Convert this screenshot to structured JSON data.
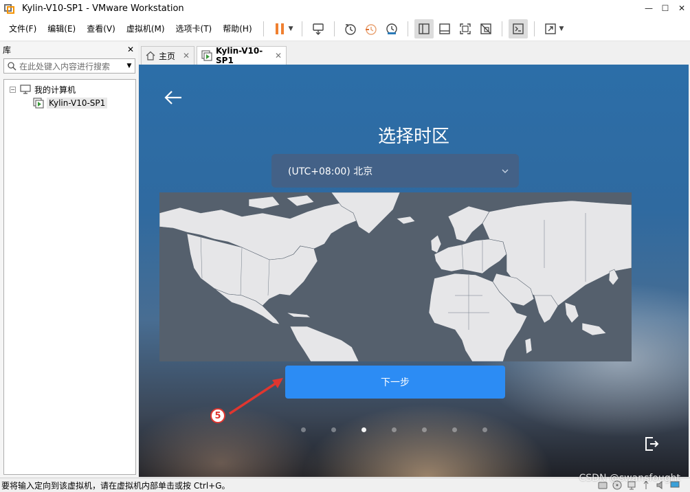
{
  "window": {
    "title": "Kylin-V10-SP1 - VMware Workstation",
    "minimize": "—",
    "maximize": "☐",
    "close": "✕"
  },
  "menu": [
    "文件(F)",
    "编辑(E)",
    "查看(V)",
    "虚拟机(M)",
    "选项卡(T)",
    "帮助(H)"
  ],
  "library": {
    "title": "库",
    "close": "✕",
    "search_placeholder": "在此处键入内容进行搜索",
    "tree_root": "我的计算机",
    "tree_toggle": "−",
    "tree_child": "Kylin-V10-SP1"
  },
  "tabs": [
    {
      "label": "主页",
      "close": "✕"
    },
    {
      "label": "Kylin-V10-SP1",
      "close": "✕"
    }
  ],
  "vm": {
    "title": "选择时区",
    "timezone_value": "(UTC+08:00) 北京",
    "next_button": "下一步",
    "page_dots": 7,
    "active_dot": 3
  },
  "annotation": {
    "number": "5",
    "color": "#e0362f"
  },
  "statusbar": {
    "text": "要将输入定向到该虚拟机，请在虚拟机内部单击或按 Ctrl+G。"
  },
  "watermark": "CSDN @swansfought",
  "colors": {
    "accent": "#2c8cf4",
    "pause": "#f08030",
    "map_ocean": "#55606d",
    "map_land": "#e6e6e8"
  }
}
